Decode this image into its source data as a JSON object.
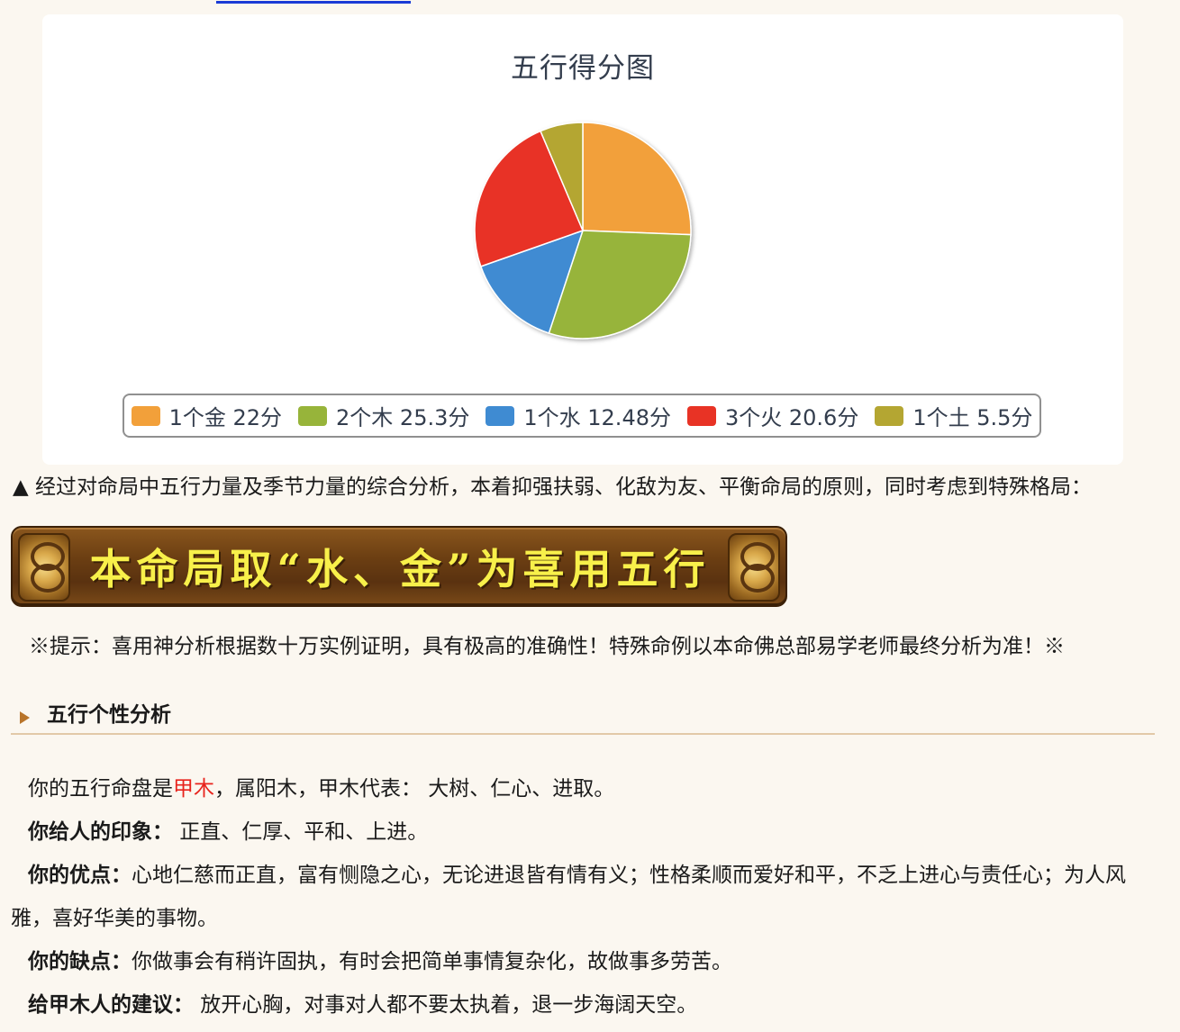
{
  "chart_data": {
    "type": "pie",
    "title": "五行得分图",
    "slices": [
      {
        "label": "1个金 22分",
        "value": 22,
        "color": "#f2a03a"
      },
      {
        "label": "2个木 25.3分",
        "value": 25.3,
        "color": "#97b43a"
      },
      {
        "label": "1个水 12.48分",
        "value": 12.48,
        "color": "#3f8bd2"
      },
      {
        "label": "3个火 20.6分",
        "value": 20.6,
        "color": "#e83325"
      },
      {
        "label": "1个土 5.5分",
        "value": 5.5,
        "color": "#b4a632"
      }
    ],
    "legend_position": "bottom"
  },
  "intro": "▲ 经过对命局中五行力量及季节力量的综合分析，本着抑强扶弱、化敌为友、平衡命局的原则，同时考虑到特殊格局：",
  "banner": "本命局取“水、金”为喜用五行",
  "tip": "※提示：喜用神分析根据数十万实例证明，具有极高的准确性！特殊命例以本命佛总部易学老师最终分析为准！※",
  "section": {
    "title": "五行个性分析"
  },
  "analysis": {
    "line1_pre": "你的五行命盘是",
    "line1_highlight": "甲木",
    "line1_post": "，属阳木，甲木代表： 大树、仁心、进取。",
    "impression_label": "你给人的印象：",
    "impression_text": " 正直、仁厚、平和、上进。",
    "strengths_label": "你的优点：",
    "strengths_text": "心地仁慈而正直，富有恻隐之心，无论进退皆有情有义；性格柔顺而爱好和平，不乏上进心与责任心；为人风雅，喜好华美的事物。",
    "weaknesses_label": "你的缺点：",
    "weaknesses_text": "你做事会有稍许固执，有时会把简单事情复杂化，故做事多劳苦。",
    "advice_label": "给甲木人的建议：",
    "advice_text": " 放开心胸，对事对人都不要太执着，退一步海阔天空。"
  }
}
